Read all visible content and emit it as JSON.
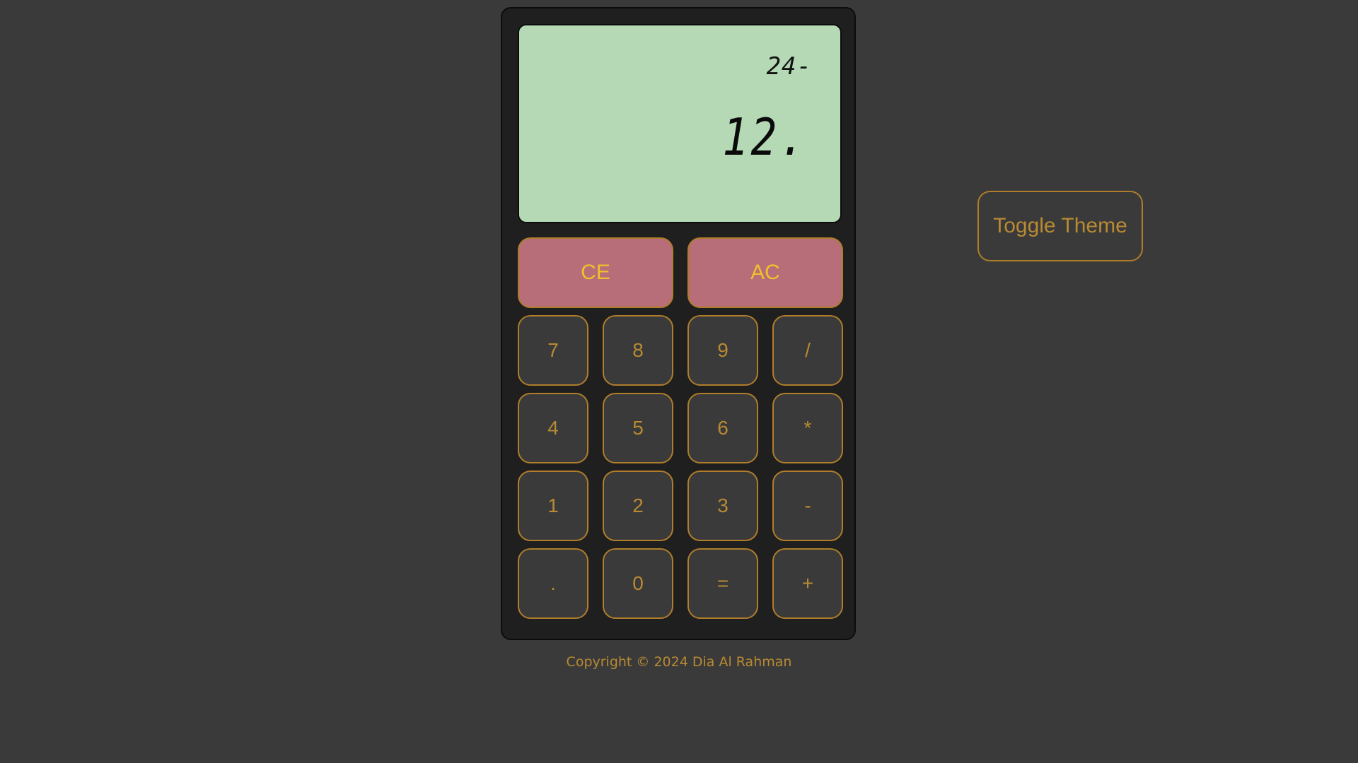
{
  "display": {
    "expression": "24-",
    "value": "12."
  },
  "keys": {
    "clear_entry": "CE",
    "all_clear": "AC",
    "rows": [
      [
        "7",
        "8",
        "9",
        "/"
      ],
      [
        "4",
        "5",
        "6",
        "*"
      ],
      [
        "1",
        "2",
        "3",
        "-"
      ],
      [
        ".",
        "0",
        "=",
        "+"
      ]
    ]
  },
  "toggle_theme": "Toggle Theme",
  "footer": {
    "copyright": "Copyright © 2024 Dia Al Rahman"
  },
  "colors": {
    "background": "#3a3a3a",
    "calculator_body": "#1f1f1f",
    "screen": "#b4d9b4",
    "accent": "#b88a32",
    "clear_button": "#b76e78",
    "clear_text": "#f1c02d"
  }
}
